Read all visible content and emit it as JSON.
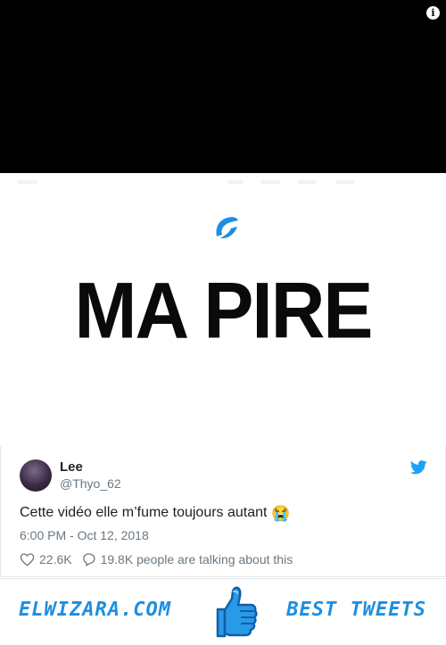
{
  "media": {
    "title_text": "MA PIRE",
    "info_glyph": "i",
    "icons": [
      "info-icon",
      "play-logo-icon"
    ]
  },
  "tweet": {
    "user_name": "Lee",
    "user_handle": "@Thyo_62",
    "text": "Cette vidéo elle m’fume toujours autant",
    "emoji": "😭",
    "timestamp": "6:00 PM - Oct 12, 2018",
    "likes": "22.6K",
    "talking": "19.8K people are talking about this",
    "icons": [
      "twitter-bird-icon",
      "heart-icon",
      "reply-icon"
    ]
  },
  "footer": {
    "left_label": "ELWIZARA.COM",
    "right_label": "BEST TWEETS",
    "icon": "thumbs-up-icon"
  },
  "colors": {
    "twitter_blue": "#1da1f2",
    "footer_blue": "#1d8fe1",
    "text_dark": "#1c2022",
    "text_muted": "#697882",
    "media_black": "#000000"
  }
}
